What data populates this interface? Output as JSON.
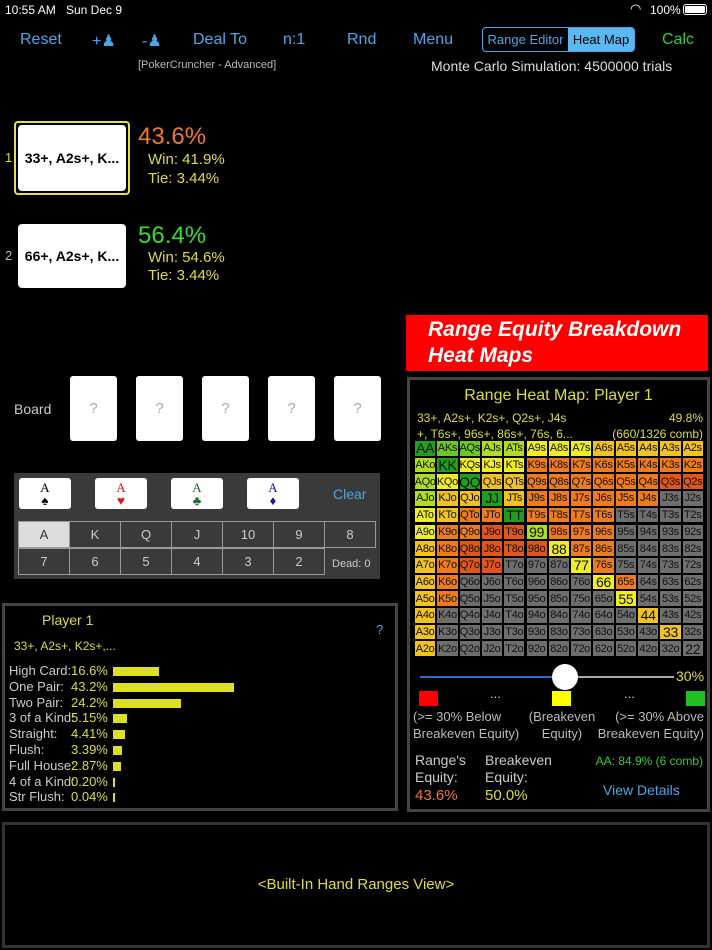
{
  "status": {
    "time": "10:55 AM",
    "date": "Sun Dec 9",
    "battery": "100%"
  },
  "toolbar": {
    "reset": "Reset",
    "add_player": "+",
    "remove_player": "-",
    "deal_to": "Deal To",
    "n": "n:1",
    "rnd": "Rnd",
    "menu": "Menu",
    "range_editor": "Range Editor",
    "heat_map": "Heat Map",
    "calc": "Calc"
  },
  "subtitle": "[PokerCruncher - Advanced]",
  "simulation": "Monte Carlo Simulation: 4500000 trials",
  "players": [
    {
      "num": "1",
      "range": "33+, A2s+, K...",
      "equity": "43.6%",
      "win": "Win: 41.9%",
      "tie": "Tie:  3.44%"
    },
    {
      "num": "2",
      "range": "66+, A2s+, K...",
      "equity": "56.4%",
      "win": "Win: 54.6%",
      "tie": "Tie:  3.44%"
    }
  ],
  "banner": {
    "line1": "Range Equity Breakdown",
    "line2": "Heat Maps"
  },
  "board": {
    "label": "Board",
    "cards": [
      "?",
      "?",
      "?",
      "?",
      "?"
    ]
  },
  "picker": {
    "aces": [
      {
        "rank": "A",
        "suit": "♠",
        "color": "#000"
      },
      {
        "rank": "A",
        "suit": "♥",
        "color": "#e01818"
      },
      {
        "rank": "A",
        "suit": "♣",
        "color": "#1a6a2a"
      },
      {
        "rank": "A",
        "suit": "♦",
        "color": "#1a1a8a"
      }
    ],
    "clear": "Clear",
    "ranks_row1": [
      "A",
      "K",
      "Q",
      "J",
      "10",
      "9",
      "8"
    ],
    "ranks_row2": [
      "7",
      "6",
      "5",
      "4",
      "3",
      "2"
    ],
    "selected": "A",
    "dead": "Dead: 0"
  },
  "stats": {
    "title": "Player 1",
    "help": "?",
    "range": "33+, A2s+, K2s+,...",
    "rows": [
      {
        "label": "High Card:",
        "pct": "16.6%",
        "value": 16.6
      },
      {
        "label": "One Pair:",
        "pct": "43.2%",
        "value": 43.2
      },
      {
        "label": "Two Pair:",
        "pct": "24.2%",
        "value": 24.2
      },
      {
        "label": "3 of a Kind:",
        "pct": "5.15%",
        "value": 5.15
      },
      {
        "label": "Straight:",
        "pct": "4.41%",
        "value": 4.41
      },
      {
        "label": "Flush:",
        "pct": "3.39%",
        "value": 3.39
      },
      {
        "label": "Full House:",
        "pct": "2.87%",
        "value": 2.87
      },
      {
        "label": "4 of a Kind:",
        "pct": "0.20%",
        "value": 0.2
      },
      {
        "label": "Str Flush:",
        "pct": "0.04%",
        "value": 0.04
      }
    ]
  },
  "heatmap": {
    "title": "Range Heat Map: Player 1",
    "range_line1": "33+, A2s+, K2s+, Q2s+, J4s",
    "range_line2": "+, T6s+, 96s+, 86s+, 76s, 6...",
    "equity": "49.8%",
    "combos": "(660/1326 comb)",
    "colors": {
      "G": "#1f9e1f",
      "g": "#6cc822",
      "l": "#b0dc22",
      "y": "#eeee22",
      "Y": "#f2c21e",
      "O": "#ee7c1c",
      "R": "#e2561a",
      "x": "#6e6e6e"
    },
    "rows": [
      {
        "hands": "AA AKs AQs AJs ATs A9s A8s A7s A6s A5s A4s A3s A2s",
        "codes": "GggllyyyYYYYY"
      },
      {
        "hands": "AKo KK KQs KJs KTs K9s K8s K7s K6s K5s K4s K3s K2s",
        "codes": "lGyyyOOOOOOOO"
      },
      {
        "hands": "AQo KQo QQ QJs QTs Q9s Q8s Q7s Q6s Q5s Q4s Q3s Q2s",
        "codes": "lyGYYOOOOOORR"
      },
      {
        "hands": "AJo KJo QJo JJ JTs J9s J8s J7s J6s J5s J4s J3s J2s",
        "codes": "lYYGYOOOOOOxx"
      },
      {
        "hands": "ATo KTo QTo JTo TT T9s T8s T7s T6s T5s T4s T3s T2s",
        "codes": "yYOOGOOOOxxxx"
      },
      {
        "hands": "A9o K9o Q9o J9o T9o 99 98s 97s 96s 95s 94s 93s 92s",
        "codes": "yOORRlOOOxxxx"
      },
      {
        "hands": "A8o K8o Q8o J8o T8o 98o 88 87s 86s 85s 84s 83s 82s",
        "codes": "YORRRRyOOxxxx"
      },
      {
        "hands": "A7o K7o Q7o J7o T7o 97o 87o 77 76s 75s 74s 73s 72s",
        "codes": "YORRxxxyOxxxx"
      },
      {
        "hands": "A6o K6o Q6o J6o T6o 96o 86o 76o 66 65s 64s 63s 62s",
        "codes": "YOxxxxxxyOxxx"
      },
      {
        "hands": "A5o K5o Q5o J5o T5o 95o 85o 75o 65o 55 54s 53s 52s",
        "codes": "YOxxxxxxxyxxx"
      },
      {
        "hands": "A4o K4o Q4o J4o T4o 94o 84o 74o 64o 54o 44 43s 42s",
        "codes": "YxxxxxxxxxYxx"
      },
      {
        "hands": "A3o K3o Q3o J3o T3o 93o 83o 73o 63o 53o 43o 33 32s",
        "codes": "YxxxxxxxxxxYx"
      },
      {
        "hands": "A2o K2o Q2o J2o T2o 92o 82o 72o 62o 52o 42o 32o 22",
        "codes": "Yxxxxxxxxxxxx"
      }
    ],
    "slider": {
      "value": 30,
      "label": "30%"
    },
    "legend": {
      "dots": "...",
      "below": [
        "(>= 30% Below",
        "Breakeven Equity)"
      ],
      "even": [
        "(Breakeven",
        "Equity)"
      ],
      "above": [
        "(>= 30% Above",
        "Breakeven Equity)"
      ],
      "red": "#ff0000",
      "yellow": "#ffff00",
      "green": "#22c022"
    },
    "range_equity_label": [
      "Range's",
      "Equity:"
    ],
    "range_equity": "43.6%",
    "breakeven_label": [
      "Breakeven",
      "Equity:"
    ],
    "breakeven": "50.0%",
    "selected_hand": "AA: 84.9% (6 comb)",
    "view_details": "View Details"
  },
  "bottom": {
    "text": "<Built-In Hand Ranges View>"
  }
}
